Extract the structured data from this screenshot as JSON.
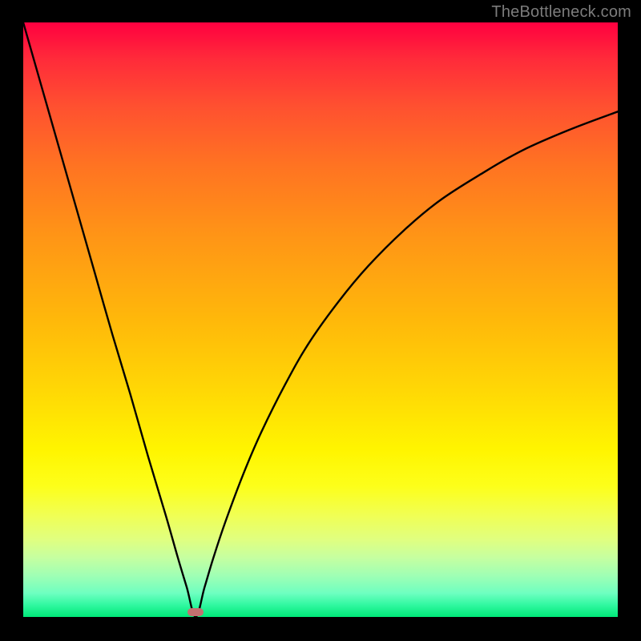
{
  "watermark": "TheBottleneck.com",
  "chart_data": {
    "type": "line",
    "title": "",
    "xlabel": "",
    "ylabel": "",
    "xlim": [
      0,
      100
    ],
    "ylim": [
      0,
      100
    ],
    "minimum_point": {
      "x": 29,
      "y": 0
    },
    "series": [
      {
        "name": "bottleneck-curve",
        "x": [
          0,
          3,
          6,
          9,
          12,
          15,
          18,
          21,
          24,
          26,
          27.5,
          29,
          30.5,
          32,
          34,
          37,
          40,
          44,
          48,
          53,
          58,
          64,
          70,
          77,
          84,
          92,
          100
        ],
        "y": [
          100,
          89.5,
          79,
          68.5,
          58,
          47.5,
          37.5,
          27,
          17,
          10,
          5,
          0,
          5,
          10,
          16,
          24,
          31,
          39,
          46,
          53,
          59,
          65,
          70,
          74.5,
          78.5,
          82,
          85
        ]
      }
    ],
    "marker": {
      "x_pct": 29,
      "y_pct": 99.2
    },
    "colors": {
      "curve": "#000000",
      "marker": "#c47070",
      "gradient_top": "#ff0040",
      "gradient_bottom": "#00e878",
      "frame": "#000000",
      "watermark": "#7c7c7c"
    }
  }
}
